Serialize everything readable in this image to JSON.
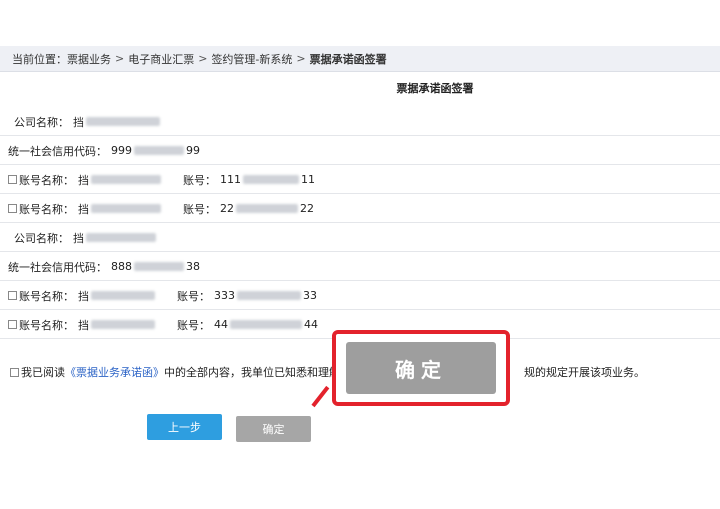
{
  "breadcrumb": {
    "prefix": "当前位置：",
    "items": [
      "票据业务",
      "电子商业汇票",
      "签约管理-新系统"
    ],
    "current": "票据承诺函签署",
    "separator": ">"
  },
  "page_title": "票据承诺函签署",
  "company1": {
    "name_label": "公司名称：",
    "name_prefix": "挡",
    "credit_label": "统一社会信用代码：",
    "credit_start": "999",
    "credit_end": "99",
    "accounts": [
      {
        "name_label": "账号名称：",
        "name_prefix": "挡",
        "acct_label": "账号：",
        "acct_start": "111",
        "acct_end": "11"
      },
      {
        "name_label": "账号名称：",
        "name_prefix": "挡",
        "acct_label": "账号：",
        "acct_start": "22",
        "acct_end": "22"
      }
    ]
  },
  "company2": {
    "name_label": "公司名称：",
    "name_prefix": "挡",
    "credit_label": "统一社会信用代码：",
    "credit_start": "888",
    "credit_end": "38",
    "accounts": [
      {
        "name_label": "账号名称：",
        "name_prefix": "挡",
        "acct_label": "账号：",
        "acct_start": "333",
        "acct_end": "33"
      },
      {
        "name_label": "账号名称：",
        "name_prefix": "挡",
        "acct_label": "账号：",
        "acct_start": "44",
        "acct_end": "44"
      }
    ]
  },
  "agreement": {
    "text_before": "我已阅读",
    "link_text": "《票据业务承诺函》",
    "text_after": "中的全部内容，我单位已知悉和理解，",
    "text_tail": "规的规定开展该项业务。"
  },
  "buttons": {
    "prev": "上一步",
    "confirm": "确定"
  },
  "callout": {
    "label": "确定",
    "border_color": "#e3222c"
  }
}
